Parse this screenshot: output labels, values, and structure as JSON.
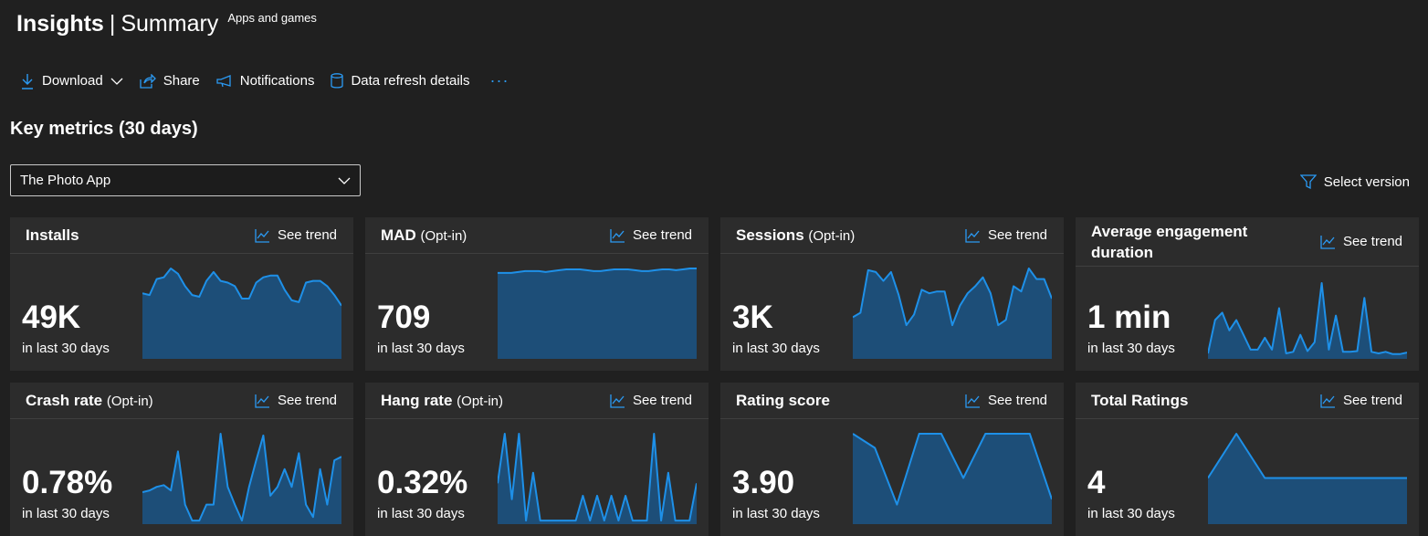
{
  "header": {
    "title": "Insights",
    "separator": "|",
    "subtitle": "Summary",
    "context": "Apps and games"
  },
  "toolbar": {
    "download": "Download",
    "share": "Share",
    "notifications": "Notifications",
    "data_refresh": "Data refresh details",
    "more": "···"
  },
  "section_title": "Key metrics (30 days)",
  "app_select": {
    "value": "The Photo App"
  },
  "select_version": "Select version",
  "see_trend": "See trend",
  "accent_color": "#1e90e8",
  "fill_color": "#1d4e78",
  "cards": [
    {
      "title": "Installs",
      "optin": "",
      "value": "49K",
      "caption": "in last 30 days",
      "trend": [
        0.72,
        0.7,
        0.88,
        0.9,
        1.0,
        0.94,
        0.8,
        0.7,
        0.68,
        0.86,
        0.96,
        0.86,
        0.84,
        0.8,
        0.66,
        0.66,
        0.84,
        0.9,
        0.92,
        0.92,
        0.76,
        0.64,
        0.62,
        0.84,
        0.86,
        0.86,
        0.8,
        0.7,
        0.58
      ]
    },
    {
      "title": "MAD",
      "optin": "(Opt-in)",
      "value": "709",
      "caption": "in last 30 days",
      "trend": [
        0.95,
        0.95,
        0.95,
        0.96,
        0.97,
        0.97,
        0.97,
        0.96,
        0.97,
        0.98,
        0.99,
        0.99,
        0.99,
        0.98,
        0.97,
        0.97,
        0.98,
        0.99,
        0.99,
        0.99,
        0.98,
        0.97,
        0.97,
        0.98,
        0.99,
        0.99,
        0.98,
        0.99,
        1.0,
        1.0
      ]
    },
    {
      "title": "Sessions",
      "optin": "(Opt-in)",
      "value": "3K",
      "caption": "in last 30 days",
      "trend": [
        0.45,
        0.5,
        0.98,
        0.96,
        0.86,
        0.96,
        0.7,
        0.36,
        0.48,
        0.76,
        0.72,
        0.74,
        0.74,
        0.36,
        0.58,
        0.72,
        0.8,
        0.9,
        0.72,
        0.36,
        0.42,
        0.8,
        0.74,
        1.0,
        0.88,
        0.88,
        0.66
      ]
    },
    {
      "title": "Average engagement duration",
      "optin": "",
      "value": "1 min",
      "caption": "in last 30 days",
      "trend": [
        0.05,
        0.5,
        0.6,
        0.36,
        0.5,
        0.3,
        0.1,
        0.1,
        0.26,
        0.1,
        0.66,
        0.05,
        0.07,
        0.3,
        0.08,
        0.2,
        1.0,
        0.1,
        0.56,
        0.07,
        0.07,
        0.08,
        0.8,
        0.07,
        0.05,
        0.07,
        0.04,
        0.04,
        0.06
      ]
    },
    {
      "title": "Crash rate",
      "optin": "(Opt-in)",
      "value": "0.78%",
      "caption": "in last 30 days",
      "trend": [
        0.34,
        0.36,
        0.4,
        0.42,
        0.36,
        0.8,
        0.2,
        0.02,
        0.02,
        0.2,
        0.2,
        1.0,
        0.4,
        0.2,
        0.02,
        0.4,
        0.7,
        0.98,
        0.3,
        0.4,
        0.6,
        0.4,
        0.78,
        0.2,
        0.06,
        0.6,
        0.2,
        0.7,
        0.74
      ]
    },
    {
      "title": "Hang rate",
      "optin": "(Opt-in)",
      "value": "0.32%",
      "caption": "in last 30 days",
      "trend": [
        0.44,
        1.0,
        0.26,
        1.0,
        0.02,
        0.56,
        0.02,
        0.02,
        0.02,
        0.02,
        0.02,
        0.02,
        0.3,
        0.02,
        0.3,
        0.02,
        0.3,
        0.02,
        0.3,
        0.02,
        0.02,
        0.02,
        1.0,
        0.02,
        0.56,
        0.02,
        0.02,
        0.02,
        0.44
      ]
    },
    {
      "title": "Rating score",
      "optin": "",
      "value": "3.90",
      "caption": "in last 30 days",
      "trend": [
        1.0,
        0.84,
        0.2,
        1.0,
        1.0,
        0.5,
        1.0,
        1.0,
        1.0,
        0.26
      ]
    },
    {
      "title": "Total Ratings",
      "optin": "",
      "value": "4",
      "caption": "in last 30 days",
      "trend": [
        0.5,
        1.0,
        0.5,
        0.5,
        0.5,
        0.5,
        0.5,
        0.5
      ]
    }
  ]
}
